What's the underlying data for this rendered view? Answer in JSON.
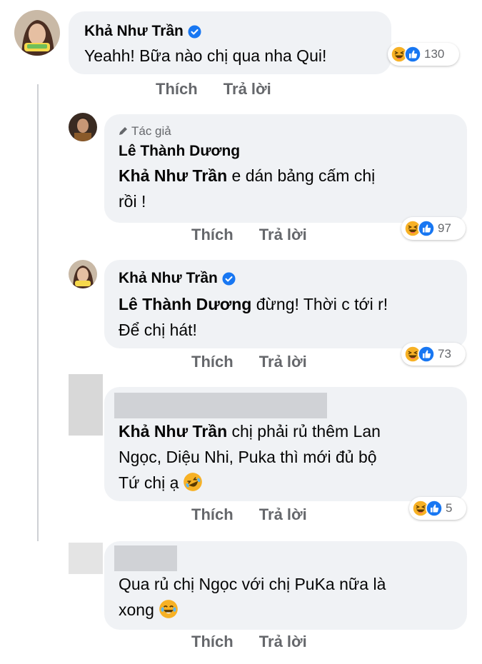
{
  "comments": [
    {
      "author": "Khả Như Trần",
      "verified": true,
      "text": "Yeahh! Bữa nào chị qua nha Qui!",
      "reaction_count": "130"
    },
    {
      "author_badge": "Tác giả",
      "author": "Lê Thành Dương",
      "mention": "Khả Như Trần",
      "text_line1": " e dán bảng cấm chị",
      "text_line2": "rồi !",
      "reaction_count": "97"
    },
    {
      "author": "Khả Như Trần",
      "verified": true,
      "mention": "Lê Thành Dương",
      "text_line1": " đừng! Thời c tới r!",
      "text_line2": "Để chị hát!",
      "reaction_count": "73"
    },
    {
      "mention": "Khả Như Trần",
      "text_line1": " chị phải rủ thêm Lan",
      "text_line2": "Ngọc, Diệu Nhi, Puka thì mới đủ bộ",
      "text_line3": "Tứ chị ạ",
      "reaction_count": "5"
    },
    {
      "text_line1": "Qua rủ chị Ngọc với chị PuKa nữa là",
      "text_line2": "xong"
    }
  ],
  "actions": {
    "like": "Thích",
    "reply": "Trả lời"
  },
  "colors": {
    "bubble": "#f0f2f5",
    "action_text": "#65676b",
    "verified_blue": "#1877f2",
    "haha_yellow": "#f7b125",
    "like_blue": "#1877f2"
  },
  "icons": [
    "verified-badge-icon",
    "pencil-icon",
    "haha-reaction-icon",
    "like-reaction-icon",
    "rolling-laugh-emoji-icon",
    "tears-of-joy-emoji-icon"
  ]
}
